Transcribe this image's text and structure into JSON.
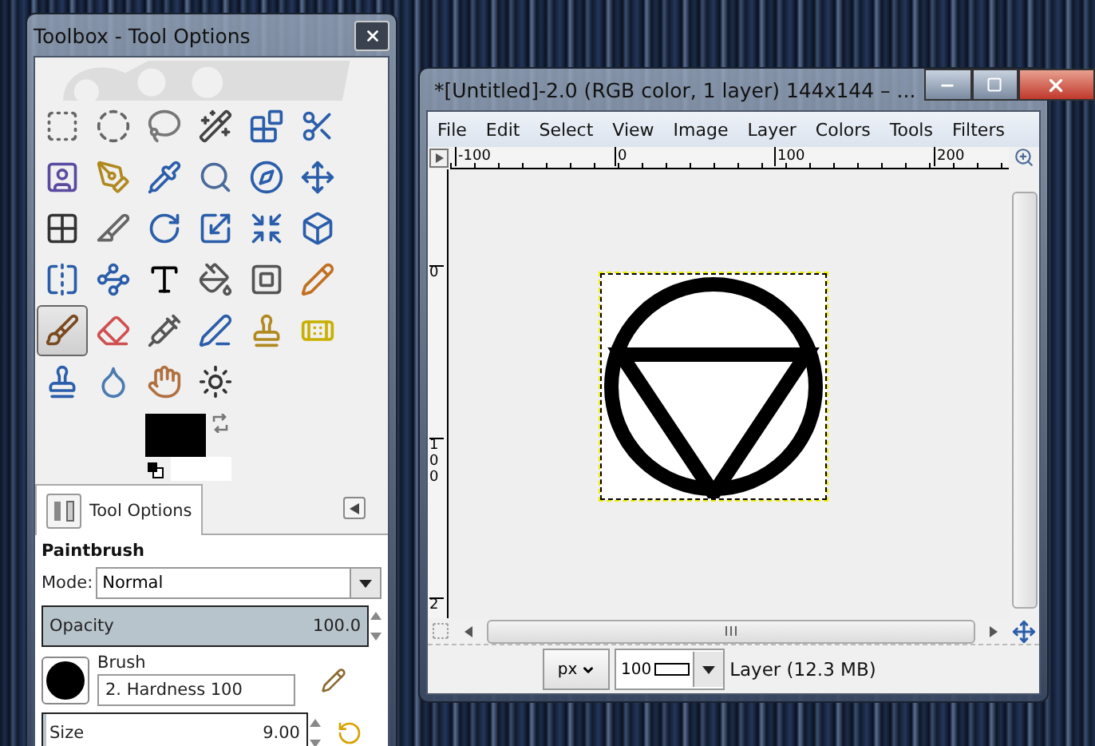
{
  "toolbox": {
    "title": "Toolbox - Tool Options",
    "tools": [
      {
        "selected": false
      },
      {
        "selected": false
      },
      {
        "selected": false
      },
      {
        "selected": false
      },
      {
        "selected": false
      },
      {
        "selected": false
      },
      {
        "selected": false
      },
      {
        "selected": false
      },
      {
        "selected": false
      },
      {
        "selected": false
      },
      {
        "selected": false
      },
      {
        "selected": false
      },
      {
        "selected": false
      },
      {
        "selected": false
      },
      {
        "selected": false
      },
      {
        "selected": false
      },
      {
        "selected": false
      },
      {
        "selected": false
      },
      {
        "selected": false
      },
      {
        "selected": false
      },
      {
        "selected": false
      },
      {
        "selected": false
      },
      {
        "selected": false
      },
      {
        "selected": false
      },
      {
        "selected": true
      },
      {
        "selected": false
      },
      {
        "selected": false
      },
      {
        "selected": false
      },
      {
        "selected": false
      },
      {
        "selected": false
      },
      {
        "selected": false
      },
      {
        "selected": false
      },
      {
        "selected": false
      },
      {
        "selected": false
      }
    ]
  },
  "tool_options": {
    "tab": {
      "label": "Tool Options",
      "selected": true
    },
    "tool_name": "Paintbrush",
    "mode": {
      "label": "Mode:",
      "value": "Normal"
    },
    "opacity": {
      "label": "Opacity",
      "value": "100.0",
      "level": 1
    },
    "brush": {
      "label": "Brush",
      "value": "2. Hardness 100"
    },
    "size": {
      "label": "Size",
      "value": "9.00",
      "level": 0.01
    }
  },
  "image_window": {
    "title": "*[Untitled]-2.0 (RGB color, 1 layer) 144x144 – ...",
    "menu": [
      "File",
      "Edit",
      "Select",
      "View",
      "Image",
      "Layer",
      "Colors",
      "Tools",
      "Filters"
    ],
    "ruler_h": [
      "-100",
      "0",
      "100",
      "200"
    ],
    "ruler_v": [
      "0",
      "100",
      "2"
    ],
    "status": {
      "unit": "px",
      "zoom": "100",
      "info": "Layer (12.3 MB)"
    }
  }
}
